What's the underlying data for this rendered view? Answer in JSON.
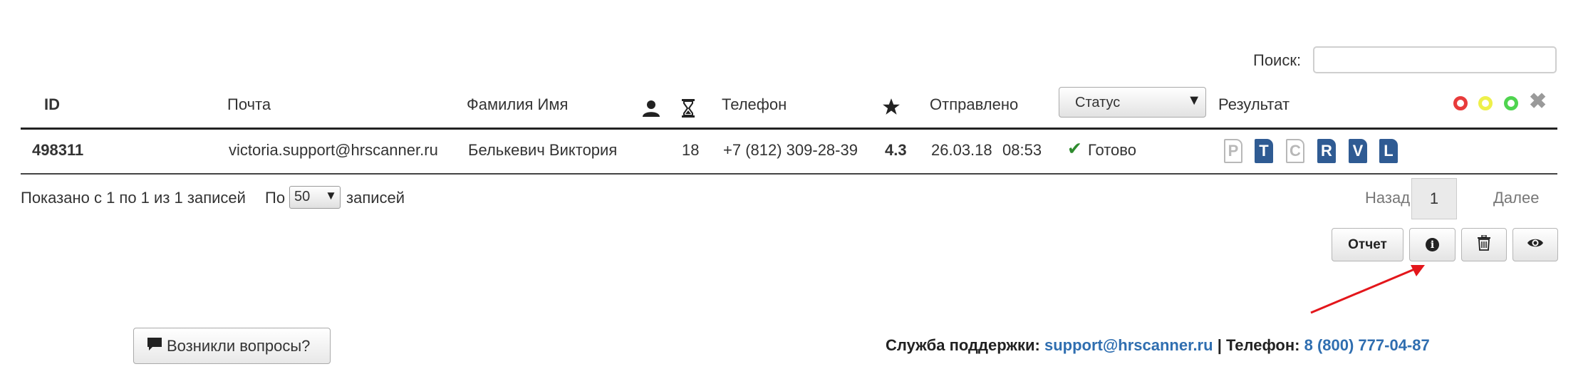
{
  "search": {
    "label": "Поиск:",
    "value": "",
    "placeholder": ""
  },
  "table": {
    "headers": {
      "id": "ID",
      "email": "Почта",
      "name": "Фамилия Имя",
      "phone": "Телефон",
      "sent": "Отправлено",
      "result": "Результат"
    },
    "status_filter": "Статус",
    "rows": [
      {
        "id": "498311",
        "email": "victoria.support@hrscanner.ru",
        "name": "Белькевич Виктория",
        "time": "18",
        "phone": "+7 (812) 309-28-39",
        "rating": "4.3",
        "sent_date": "26.03.18",
        "sent_time": "08:53",
        "status": "Готово",
        "result_docs": [
          "P",
          "T",
          "C",
          "R",
          "V",
          "L"
        ]
      }
    ]
  },
  "pagination": {
    "shown_text": "Показано с 1 по 1 из 1 записей",
    "per_page_prefix": "По",
    "per_page_value": "50",
    "per_page_suffix": "записей",
    "prev": "Назад",
    "current_page": "1",
    "next": "Далее"
  },
  "actions": {
    "report_label": "Отчет"
  },
  "footer": {
    "questions_label": "Возникли вопросы?",
    "support_label": "Служба поддержки:",
    "support_email": "support@hrscanner.ru",
    "separator": "|",
    "phone_label": "Телефон:",
    "phone": "8 (800) 777-04-87"
  },
  "colors": {
    "accent": "#2f5b93",
    "link": "#2f6eb0",
    "status_red": "#e83b3b",
    "status_yellow": "#eef04a",
    "status_green": "#4fd44f",
    "arrow": "#e3161b"
  },
  "icons": [
    "user-icon",
    "hourglass-icon",
    "star-icon",
    "check-icon",
    "info-icon",
    "trash-icon",
    "eye-icon",
    "chat-icon",
    "clear-filter-icon"
  ]
}
